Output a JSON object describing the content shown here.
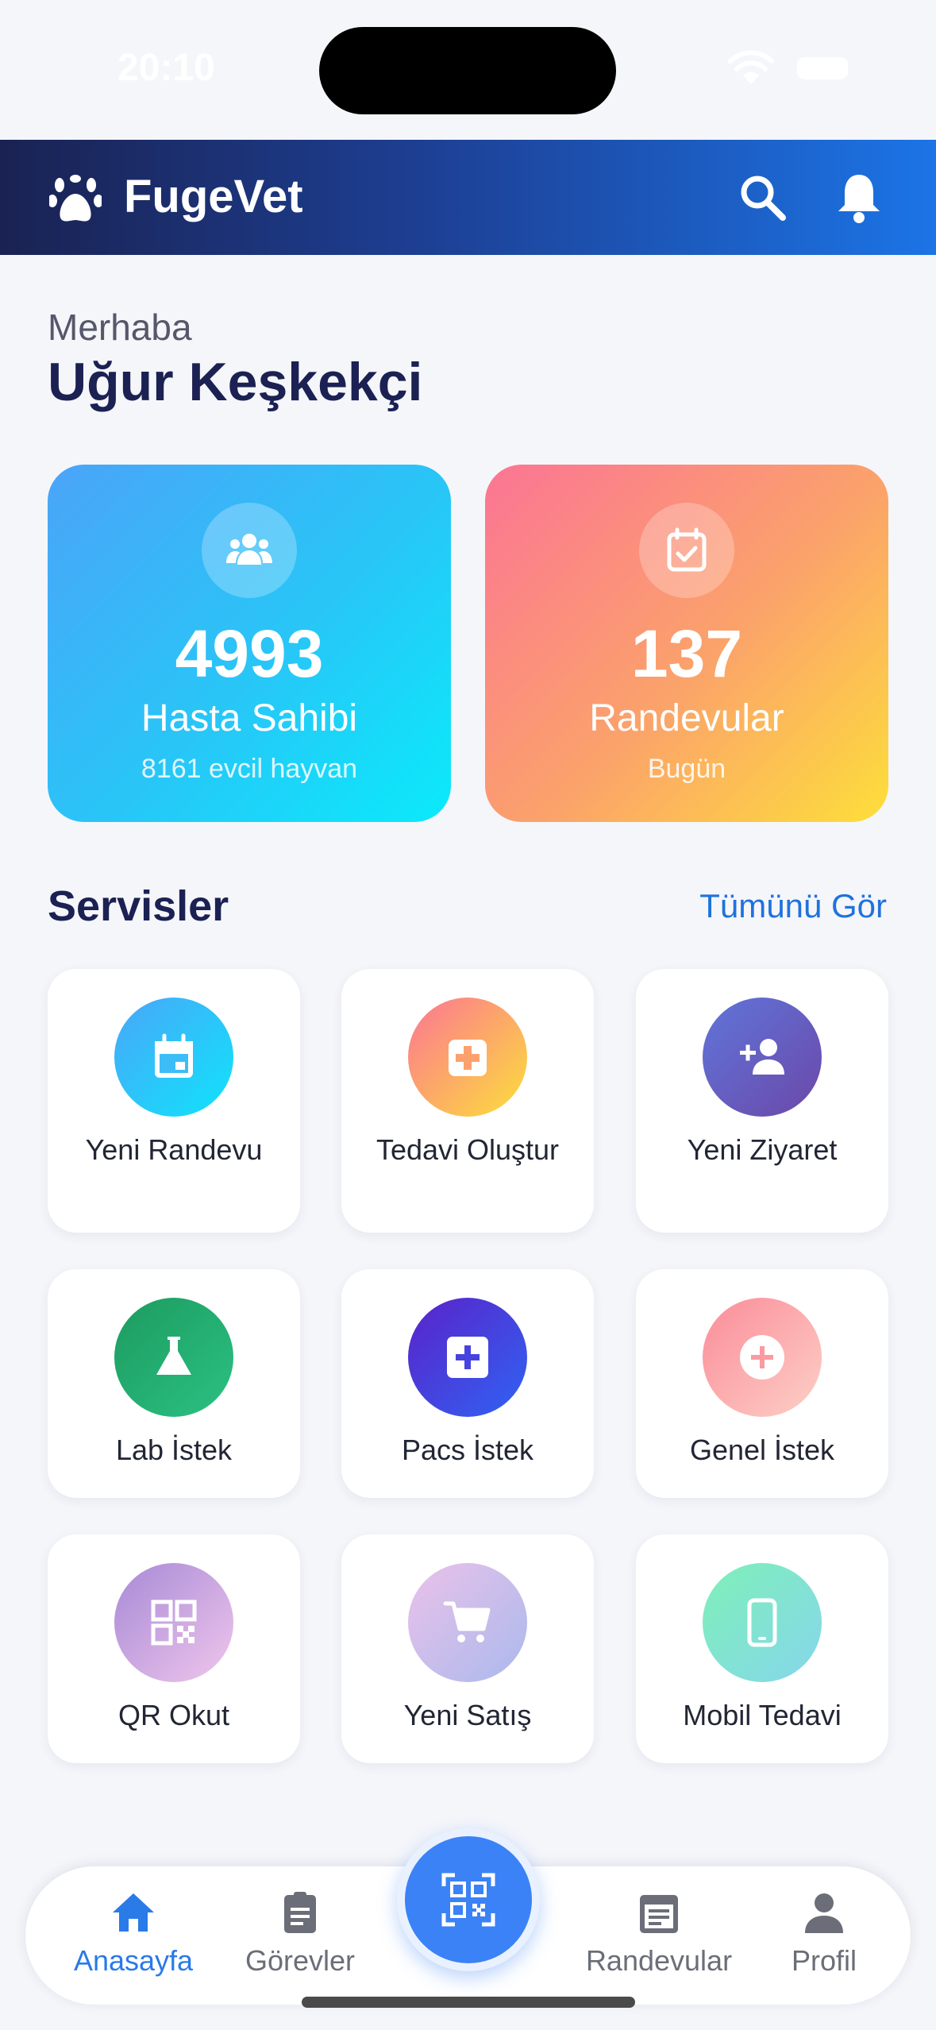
{
  "status_bar": {
    "time": "20:10"
  },
  "header": {
    "app_name": "FugeVet"
  },
  "greeting": {
    "hello": "Merhaba",
    "name": "Uğur Keşkekçi"
  },
  "stats": [
    {
      "value": "4993",
      "label": "Hasta Sahibi",
      "sub": "8161 evcil hayvan",
      "icon": "users-icon"
    },
    {
      "value": "137",
      "label": "Randevular",
      "sub": "Bugün",
      "icon": "calendar-check-icon"
    }
  ],
  "services_section": {
    "title": "Servisler",
    "see_all": "Tümünü Gör"
  },
  "services": [
    {
      "label": "Yeni Randevu",
      "icon": "calendar-icon",
      "color": "#1fc1f5"
    },
    {
      "label": "Tedavi Oluştur",
      "icon": "medical-plus-icon",
      "color": "#fb8b6f"
    },
    {
      "label": "Yeni Ziyaret",
      "icon": "add-person-icon",
      "color": "#6a5bc8"
    },
    {
      "label": "Lab İstek",
      "icon": "flask-icon",
      "color": "#22a86a"
    },
    {
      "label": "Pacs İstek",
      "icon": "plus-box-icon",
      "color": "#4b3ad8"
    },
    {
      "label": "Genel İstek",
      "icon": "plus-circle-icon",
      "color": "#fb9aa0"
    },
    {
      "label": "QR Okut",
      "icon": "qr-icon",
      "color": "#c39ae0"
    },
    {
      "label": "Yeni Satış",
      "icon": "cart-icon",
      "color": "#c9b7ea"
    },
    {
      "label": "Mobil Tedavi",
      "icon": "phone-icon",
      "color": "#7fe0c8"
    }
  ],
  "tab_bar": {
    "items": [
      {
        "label": "Anasayfa",
        "icon": "home-icon",
        "active": true
      },
      {
        "label": "Görevler",
        "icon": "clipboard-icon",
        "active": false
      },
      {
        "label": "Randevular",
        "icon": "calendar-list-icon",
        "active": false
      },
      {
        "label": "Profil",
        "icon": "person-icon",
        "active": false
      }
    ],
    "center_action": {
      "icon": "qr-scan-icon"
    }
  }
}
